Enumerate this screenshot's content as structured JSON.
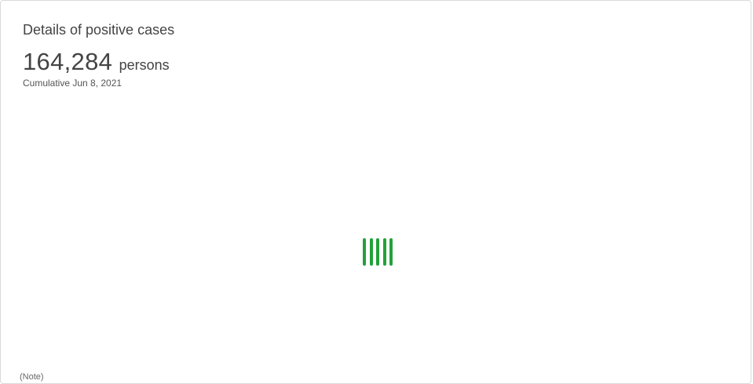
{
  "card": {
    "title": "Details of positive cases",
    "total_count": "164,284",
    "unit": "persons",
    "as_of": "Cumulative Jun 8, 2021",
    "footnote": "(Note)"
  },
  "loading_indicator": {
    "icon": "loading-bars-icon",
    "bar_count": 5,
    "color": "#22a13a"
  },
  "colors": {
    "card_border": "#d9d9d9",
    "text_primary": "#444444",
    "text_secondary": "#555555"
  }
}
